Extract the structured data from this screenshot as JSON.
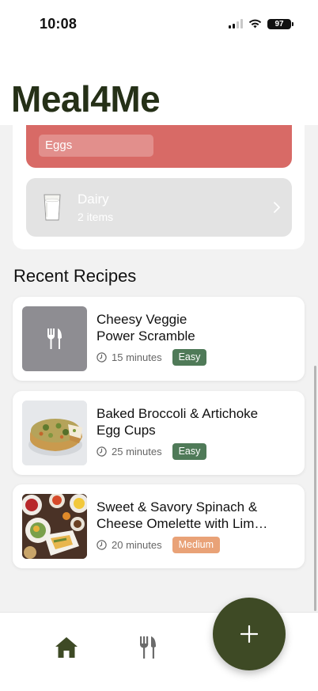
{
  "status_bar": {
    "time": "10:08",
    "battery": "97"
  },
  "app": {
    "title": "Meal4Me"
  },
  "pantry": {
    "eggs_category": {
      "item": "Eggs",
      "color": "#d86a66"
    },
    "dairy_category": {
      "name": "Dairy",
      "count": "2 items",
      "icon": "milk-glass-icon"
    }
  },
  "recent": {
    "section_title": "Recent Recipes",
    "recipes": [
      {
        "title_line1": "Cheesy Veggie",
        "title_line2": "Power Scramble",
        "time": "15 minutes",
        "difficulty": "Easy",
        "image": "utensils-placeholder"
      },
      {
        "title_line1": "Baked Broccoli & Artichoke",
        "title_line2": "Egg Cups",
        "time": "25 minutes",
        "difficulty": "Easy",
        "image": "quiche-photo"
      },
      {
        "title_line1": "Sweet & Savory Spinach &",
        "title_line2": "Cheese Omelette with Lim…",
        "time": "20 minutes",
        "difficulty": "Medium",
        "image": "breakfast-spread-photo"
      }
    ]
  },
  "tab_bar": {
    "items": [
      "home-icon",
      "utensils-icon"
    ],
    "fab_icon": "plus-icon"
  },
  "colors": {
    "brand": "#253017",
    "fab": "#3e4a25",
    "easy": "#4f7a58",
    "medium": "#e9a277"
  }
}
